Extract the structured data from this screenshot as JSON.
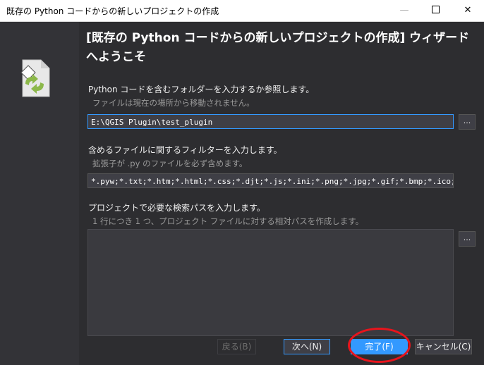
{
  "window": {
    "title": "既存の Python コードからの新しいプロジェクトの作成",
    "minimize_glyph": "—",
    "close_glyph": "✕"
  },
  "wizard": {
    "title": "[既存の Python コードからの新しいプロジェクトの作成] ウィザードへようこそ"
  },
  "source": {
    "label": "Python コードを含むフォルダーを入力するか参照します。",
    "hint": "ファイルは現在の場所から移動されません。",
    "value": "E:\\QGIS Plugin\\test_plugin",
    "browse_label": "..."
  },
  "filter": {
    "label": "含めるファイルに関するフィルターを入力します。",
    "hint": "拡張子が .py のファイルを必ず含めます。",
    "value": "*.pyw;*.txt;*.htm;*.html;*.css;*.djt;*.js;*.ini;*.png;*.jpg;*.gif;*.bmp;*.ico;*.svg"
  },
  "search_paths": {
    "label": "プロジェクトで必要な検索パスを入力します。",
    "hint": "1 行につき 1 つ、プロジェクト ファイルに対する相対パスを作成します。",
    "value": "",
    "browse_label": "..."
  },
  "buttons": {
    "back": "戻る(B)",
    "next": "次へ(N)",
    "finish": "完了(F)",
    "cancel": "キャンセル(C)"
  },
  "colors": {
    "accent": "#3399ff",
    "annotation": "#e8141c",
    "icon_green": "#8cb84a"
  }
}
